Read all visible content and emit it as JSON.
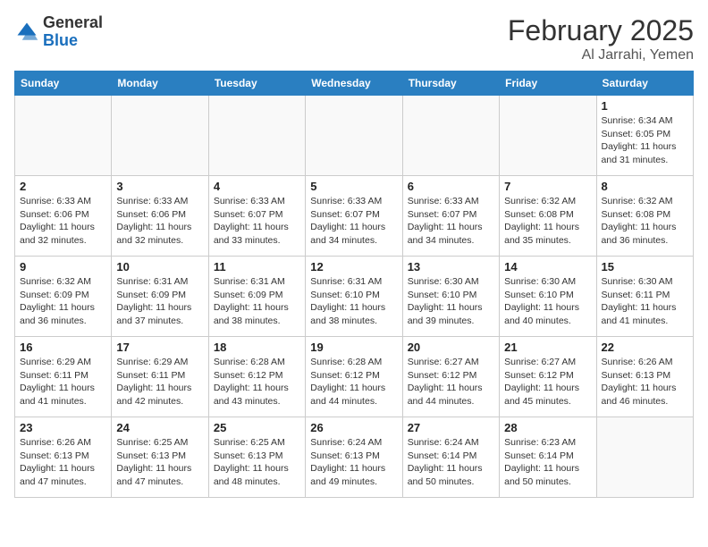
{
  "header": {
    "logo_general": "General",
    "logo_blue": "Blue",
    "month_year": "February 2025",
    "location": "Al Jarrahi, Yemen"
  },
  "days_of_week": [
    "Sunday",
    "Monday",
    "Tuesday",
    "Wednesday",
    "Thursday",
    "Friday",
    "Saturday"
  ],
  "weeks": [
    [
      {
        "day": "",
        "detail": ""
      },
      {
        "day": "",
        "detail": ""
      },
      {
        "day": "",
        "detail": ""
      },
      {
        "day": "",
        "detail": ""
      },
      {
        "day": "",
        "detail": ""
      },
      {
        "day": "",
        "detail": ""
      },
      {
        "day": "1",
        "detail": "Sunrise: 6:34 AM\nSunset: 6:05 PM\nDaylight: 11 hours and 31 minutes."
      }
    ],
    [
      {
        "day": "2",
        "detail": "Sunrise: 6:33 AM\nSunset: 6:06 PM\nDaylight: 11 hours and 32 minutes."
      },
      {
        "day": "3",
        "detail": "Sunrise: 6:33 AM\nSunset: 6:06 PM\nDaylight: 11 hours and 32 minutes."
      },
      {
        "day": "4",
        "detail": "Sunrise: 6:33 AM\nSunset: 6:07 PM\nDaylight: 11 hours and 33 minutes."
      },
      {
        "day": "5",
        "detail": "Sunrise: 6:33 AM\nSunset: 6:07 PM\nDaylight: 11 hours and 34 minutes."
      },
      {
        "day": "6",
        "detail": "Sunrise: 6:33 AM\nSunset: 6:07 PM\nDaylight: 11 hours and 34 minutes."
      },
      {
        "day": "7",
        "detail": "Sunrise: 6:32 AM\nSunset: 6:08 PM\nDaylight: 11 hours and 35 minutes."
      },
      {
        "day": "8",
        "detail": "Sunrise: 6:32 AM\nSunset: 6:08 PM\nDaylight: 11 hours and 36 minutes."
      }
    ],
    [
      {
        "day": "9",
        "detail": "Sunrise: 6:32 AM\nSunset: 6:09 PM\nDaylight: 11 hours and 36 minutes."
      },
      {
        "day": "10",
        "detail": "Sunrise: 6:31 AM\nSunset: 6:09 PM\nDaylight: 11 hours and 37 minutes."
      },
      {
        "day": "11",
        "detail": "Sunrise: 6:31 AM\nSunset: 6:09 PM\nDaylight: 11 hours and 38 minutes."
      },
      {
        "day": "12",
        "detail": "Sunrise: 6:31 AM\nSunset: 6:10 PM\nDaylight: 11 hours and 38 minutes."
      },
      {
        "day": "13",
        "detail": "Sunrise: 6:30 AM\nSunset: 6:10 PM\nDaylight: 11 hours and 39 minutes."
      },
      {
        "day": "14",
        "detail": "Sunrise: 6:30 AM\nSunset: 6:10 PM\nDaylight: 11 hours and 40 minutes."
      },
      {
        "day": "15",
        "detail": "Sunrise: 6:30 AM\nSunset: 6:11 PM\nDaylight: 11 hours and 41 minutes."
      }
    ],
    [
      {
        "day": "16",
        "detail": "Sunrise: 6:29 AM\nSunset: 6:11 PM\nDaylight: 11 hours and 41 minutes."
      },
      {
        "day": "17",
        "detail": "Sunrise: 6:29 AM\nSunset: 6:11 PM\nDaylight: 11 hours and 42 minutes."
      },
      {
        "day": "18",
        "detail": "Sunrise: 6:28 AM\nSunset: 6:12 PM\nDaylight: 11 hours and 43 minutes."
      },
      {
        "day": "19",
        "detail": "Sunrise: 6:28 AM\nSunset: 6:12 PM\nDaylight: 11 hours and 44 minutes."
      },
      {
        "day": "20",
        "detail": "Sunrise: 6:27 AM\nSunset: 6:12 PM\nDaylight: 11 hours and 44 minutes."
      },
      {
        "day": "21",
        "detail": "Sunrise: 6:27 AM\nSunset: 6:12 PM\nDaylight: 11 hours and 45 minutes."
      },
      {
        "day": "22",
        "detail": "Sunrise: 6:26 AM\nSunset: 6:13 PM\nDaylight: 11 hours and 46 minutes."
      }
    ],
    [
      {
        "day": "23",
        "detail": "Sunrise: 6:26 AM\nSunset: 6:13 PM\nDaylight: 11 hours and 47 minutes."
      },
      {
        "day": "24",
        "detail": "Sunrise: 6:25 AM\nSunset: 6:13 PM\nDaylight: 11 hours and 47 minutes."
      },
      {
        "day": "25",
        "detail": "Sunrise: 6:25 AM\nSunset: 6:13 PM\nDaylight: 11 hours and 48 minutes."
      },
      {
        "day": "26",
        "detail": "Sunrise: 6:24 AM\nSunset: 6:13 PM\nDaylight: 11 hours and 49 minutes."
      },
      {
        "day": "27",
        "detail": "Sunrise: 6:24 AM\nSunset: 6:14 PM\nDaylight: 11 hours and 50 minutes."
      },
      {
        "day": "28",
        "detail": "Sunrise: 6:23 AM\nSunset: 6:14 PM\nDaylight: 11 hours and 50 minutes."
      },
      {
        "day": "",
        "detail": ""
      }
    ]
  ]
}
